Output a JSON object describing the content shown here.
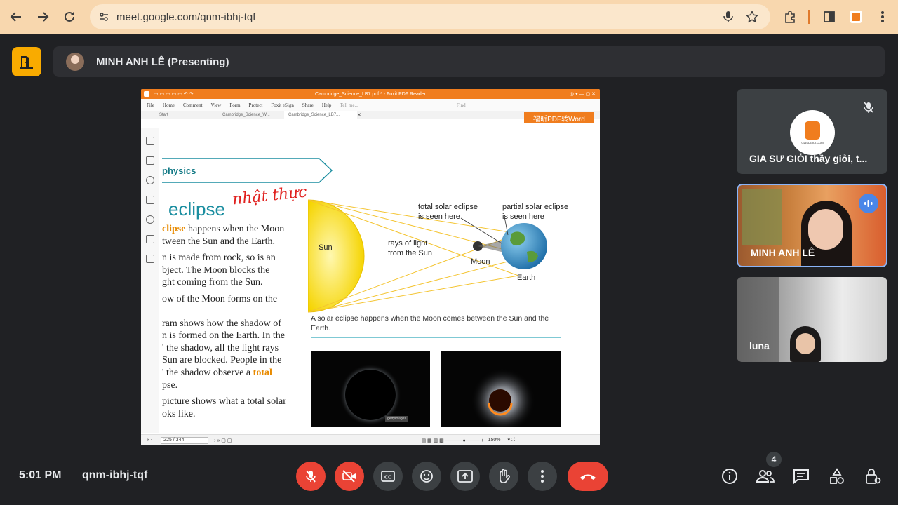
{
  "browser": {
    "url": "meet.google.com/qnm-ibhj-tqf",
    "back_icon": "arrow-left-icon",
    "forward_icon": "arrow-right-icon",
    "reload_icon": "reload-icon"
  },
  "presenter_bar": {
    "label": "MINH ANH LÊ (Presenting)"
  },
  "shared_screen": {
    "app_title": "Cambridge_Science_LB7.pdf * - Foxit PDF Reader",
    "menu": [
      "File",
      "Home",
      "Comment",
      "View",
      "Form",
      "Protect",
      "Foxit eSign",
      "Share",
      "Help"
    ],
    "tell_me": "Tell me...",
    "find": "Find",
    "tabs": [
      "Start",
      "Cambridge_Science_W...",
      "Cambridge_Science_LB7..."
    ],
    "pdf_to_word": "福昕PDF转Word",
    "page_indicator": "225 / 344",
    "zoom": "150%",
    "page": {
      "banner": "physics",
      "heading": "eclipse",
      "handwritten_note": "nhật thực",
      "paragraphs": [
        [
          "clipse",
          " happens when the Moon"
        ],
        [
          "tween the Sun and the Earth.",
          ""
        ],
        [
          "n is made from rock, so is an",
          ""
        ],
        [
          "bject. The Moon blocks the",
          ""
        ],
        [
          "ght coming from the Sun.",
          ""
        ],
        [
          "ow of the Moon forms on the",
          ""
        ],
        [
          "ram shows how the shadow of",
          ""
        ],
        [
          "n is formed on the Earth. In the",
          ""
        ],
        [
          "' the shadow, all the light rays",
          ""
        ],
        [
          "Sun are blocked. People in the",
          ""
        ],
        [
          "' the shadow observe a ",
          "total"
        ],
        [
          "pse.",
          ""
        ],
        [
          "picture shows what a total solar",
          ""
        ],
        [
          "oks like.",
          ""
        ]
      ],
      "diagram_labels": {
        "sun": "Sun",
        "rays_1": "rays of light",
        "rays_2": "from the Sun",
        "moon": "Moon",
        "earth": "Earth",
        "total_1": "total solar eclipse",
        "total_2": "is seen here",
        "partial_1": "partial solar eclipse",
        "partial_2": "is seen here"
      },
      "caption": "A solar eclipse happens when the Moon comes between the Sun and the Earth.",
      "photo_watermark": "gettyimages"
    }
  },
  "participants": [
    {
      "name": "GIA SƯ GIỎI thầy giỏi, t...",
      "muted": true,
      "logo_text": "GIASUGIOI.COM"
    },
    {
      "name": "MINH ANH LÊ",
      "speaking": true
    },
    {
      "name": "luna"
    }
  ],
  "bottom_bar": {
    "time": "5:01 PM",
    "meeting_code": "qnm-ibhj-tqf",
    "participant_count": "4",
    "controls": [
      "mic-off-icon",
      "camera-off-icon",
      "captions-icon",
      "emoji-icon",
      "present-icon",
      "raise-hand-icon",
      "more-options-icon",
      "end-call-icon"
    ],
    "right_controls": [
      "info-icon",
      "people-icon",
      "chat-icon",
      "activities-icon",
      "host-controls-icon"
    ]
  },
  "colors": {
    "chrome": "#f8d7ae",
    "meet_bg": "#202124",
    "end_call": "#ea4335",
    "foxit_orange": "#f07d1e",
    "active_tile_border": "#8ab4f8"
  }
}
